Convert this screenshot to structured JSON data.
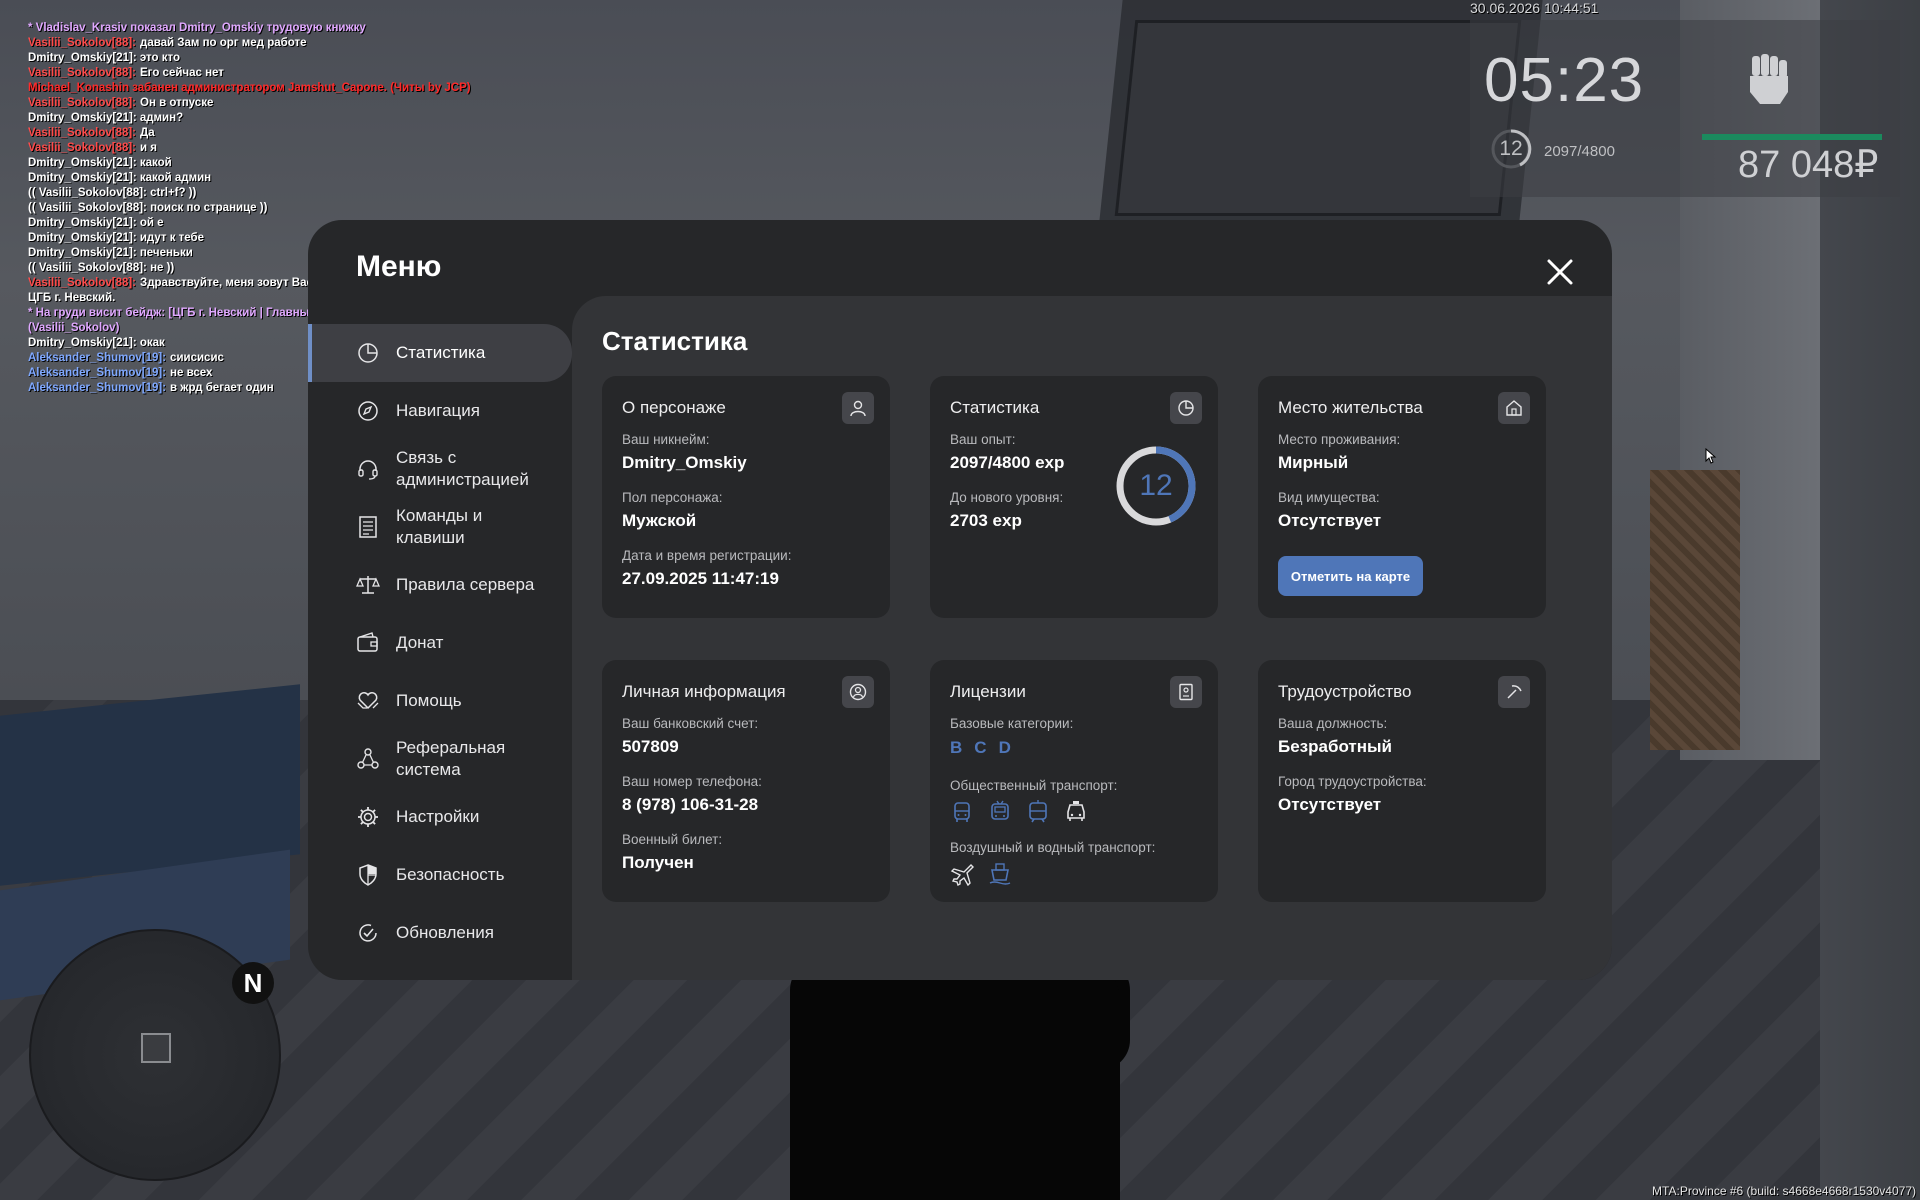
{
  "chat": [
    {
      "name": "",
      "nc": "#e0a8ff",
      "text": "* Vladislav_Krasiv показал Dmitry_Omskiy трудовую книжку",
      "tc": "#e0a8ff"
    },
    {
      "name": "Vasilii_Sokolov[88]:",
      "nc": "#ff4a4a",
      "text": "давай Зам по орг мед работе",
      "tc": "#ffffff"
    },
    {
      "name": "",
      "nc": "#ffffff",
      "text": "Dmitry_Omskiy[21]: это кто",
      "tc": "#ffffff"
    },
    {
      "name": "Vasilii_Sokolov[88]:",
      "nc": "#ff4a4a",
      "text": "Его сейчас нет",
      "tc": "#ffffff"
    },
    {
      "name": "",
      "nc": "#ff2a2a",
      "text": "Michael_Konashin забанен администратором Jamshut_Capone. (Читы by JCP)",
      "tc": "#ff2a2a"
    },
    {
      "name": "Vasilii_Sokolov[88]:",
      "nc": "#ff4a4a",
      "text": "Он в отпуске",
      "tc": "#ffffff"
    },
    {
      "name": "",
      "nc": "#ffffff",
      "text": "Dmitry_Omskiy[21]: админ?",
      "tc": "#ffffff"
    },
    {
      "name": "Vasilii_Sokolov[88]:",
      "nc": "#ff4a4a",
      "text": "Да",
      "tc": "#ffffff"
    },
    {
      "name": "Vasilii_Sokolov[88]:",
      "nc": "#ff4a4a",
      "text": "и я",
      "tc": "#ffffff"
    },
    {
      "name": "",
      "nc": "#ffffff",
      "text": "Dmitry_Omskiy[21]: какой",
      "tc": "#ffffff"
    },
    {
      "name": "",
      "nc": "#ffffff",
      "text": "Dmitry_Omskiy[21]: какой админ",
      "tc": "#ffffff"
    },
    {
      "name": "",
      "nc": "#ffffff",
      "text": "(( Vasilii_Sokolov[88]: ctrl+f? ))",
      "tc": "#ffffff"
    },
    {
      "name": "",
      "nc": "#ffffff",
      "text": "(( Vasilii_Sokolov[88]: поиск по странице ))",
      "tc": "#ffffff"
    },
    {
      "name": "",
      "nc": "#ffffff",
      "text": "Dmitry_Omskiy[21]: ой е",
      "tc": "#ffffff"
    },
    {
      "name": "",
      "nc": "#ffffff",
      "text": "Dmitry_Omskiy[21]: идут к тебе",
      "tc": "#ffffff"
    },
    {
      "name": "",
      "nc": "#ffffff",
      "text": "Dmitry_Omskiy[21]: печеньки",
      "tc": "#ffffff"
    },
    {
      "name": "",
      "nc": "#ffffff",
      "text": "(( Vasilii_Sokolov[88]: не ))",
      "tc": "#ffffff"
    },
    {
      "name": "Vasilii_Sokolov[88]:",
      "nc": "#ff4a4a",
      "text": "Здравствуйте, меня зовут Василий Соколов, я сотрудник",
      "tc": "#ffffff"
    },
    {
      "name": "",
      "nc": "#ffffff",
      "text": "ЦГБ г. Невский.",
      "tc": "#ffffff"
    },
    {
      "name": "",
      "nc": "#e0a8ff",
      "text": "* На груди висит бейдж: [ЦГБ г. Невский | Главный Врач | Василий Соколов].",
      "tc": "#e0a8ff"
    },
    {
      "name": "",
      "nc": "#e0a8ff",
      "text": "(Vasilii_Sokolov)",
      "tc": "#e0a8ff"
    },
    {
      "name": "",
      "nc": "#ffffff",
      "text": "Dmitry_Omskiy[21]: окак",
      "tc": "#ffffff"
    },
    {
      "name": "Aleksander_Shumov[19]:",
      "nc": "#7fa8ff",
      "text": "сиисисис",
      "tc": "#ffffff"
    },
    {
      "name": "Aleksander_Shumov[19]:",
      "nc": "#7fa8ff",
      "text": "не всех",
      "tc": "#ffffff"
    },
    {
      "name": "Aleksander_Shumov[19]:",
      "nc": "#7fa8ff",
      "text": "в жрд бегает один",
      "tc": "#ffffff"
    }
  ],
  "hud": {
    "datetime": "30.06.2026 10:44:51",
    "clock": "05:23",
    "level": "12",
    "exp": "2097/4800",
    "money": "87 048₽"
  },
  "minimap": {
    "north": "N"
  },
  "build": "MTA:Province #6 (build: s4668e4668r1530v4077)",
  "menu": {
    "title": "Меню",
    "nav": [
      {
        "label": "Статистика",
        "name": "nav-statistics",
        "icon": "pie-chart-icon",
        "active": true
      },
      {
        "label": "Навигация",
        "name": "nav-navigation",
        "icon": "compass-icon"
      },
      {
        "label": "Связь с\nадминистрацией",
        "name": "nav-admin-contact",
        "icon": "headset-icon"
      },
      {
        "label": "Команды и\nклавиши",
        "name": "nav-commands",
        "icon": "document-icon"
      },
      {
        "label": "Правила сервера",
        "name": "nav-rules",
        "icon": "scales-icon"
      },
      {
        "label": "Донат",
        "name": "nav-donate",
        "icon": "wallet-icon"
      },
      {
        "label": "Помощь",
        "name": "nav-help",
        "icon": "heart-hands-icon"
      },
      {
        "label": "Реферальная\nсистема",
        "name": "nav-referral",
        "icon": "network-icon"
      },
      {
        "label": "Настройки",
        "name": "nav-settings",
        "icon": "gear-icon"
      },
      {
        "label": "Безопасность",
        "name": "nav-security",
        "icon": "shield-icon"
      },
      {
        "label": "Обновления",
        "name": "nav-updates",
        "icon": "check-circle-icon"
      }
    ]
  },
  "content": {
    "heading": "Статистика",
    "character": {
      "title": "О персонаже",
      "nick_label": "Ваш никнейм:",
      "nick": "Dmitry_Omskiy",
      "sex_label": "Пол персонажа:",
      "sex": "Мужской",
      "reg_label": "Дата и время регистрации:",
      "reg": "27.09.2025 11:47:19"
    },
    "stats": {
      "title": "Статистика",
      "exp_label": "Ваш опыт:",
      "exp": "2097/4800 exp",
      "next_label": "До нового уровня:",
      "next": "2703 exp",
      "level": "12",
      "progress": 0.437
    },
    "residence": {
      "title": "Место жительства",
      "place_label": "Место проживания:",
      "place": "Мирный",
      "property_label": "Вид имущества:",
      "property": "Отсутствует",
      "button": "Отметить на карте"
    },
    "personal": {
      "title": "Личная информация",
      "bank_label": "Ваш банковский счет:",
      "bank": "507809",
      "phone_label": "Ваш номер телефона:",
      "phone": "8 (978) 106-31-28",
      "military_label": "Военный билет:",
      "military": "Получен"
    },
    "licenses": {
      "title": "Лицензии",
      "basic_label": "Базовые категории:",
      "basic": [
        "B",
        "C",
        "D"
      ],
      "public_label": "Общественный транспорт:",
      "public_icons": [
        "bus-icon",
        "trolleybus-icon",
        "tram-icon",
        "taxi-icon"
      ],
      "air_label": "Воздушный и водный транспорт:",
      "air_icons": [
        "plane-icon",
        "boat-icon"
      ]
    },
    "job": {
      "title": "Трудоустройство",
      "position_label": "Ваша должность:",
      "position": "Безработный",
      "city_label": "Город трудоустройства:",
      "city": "Отсутствует"
    }
  },
  "colors": {
    "accent": "#4f76b8",
    "hp": "#1b8a5e",
    "nick_red": "#ff4a4a",
    "nick_blue": "#7fa8ff",
    "emote": "#e0a8ff"
  }
}
